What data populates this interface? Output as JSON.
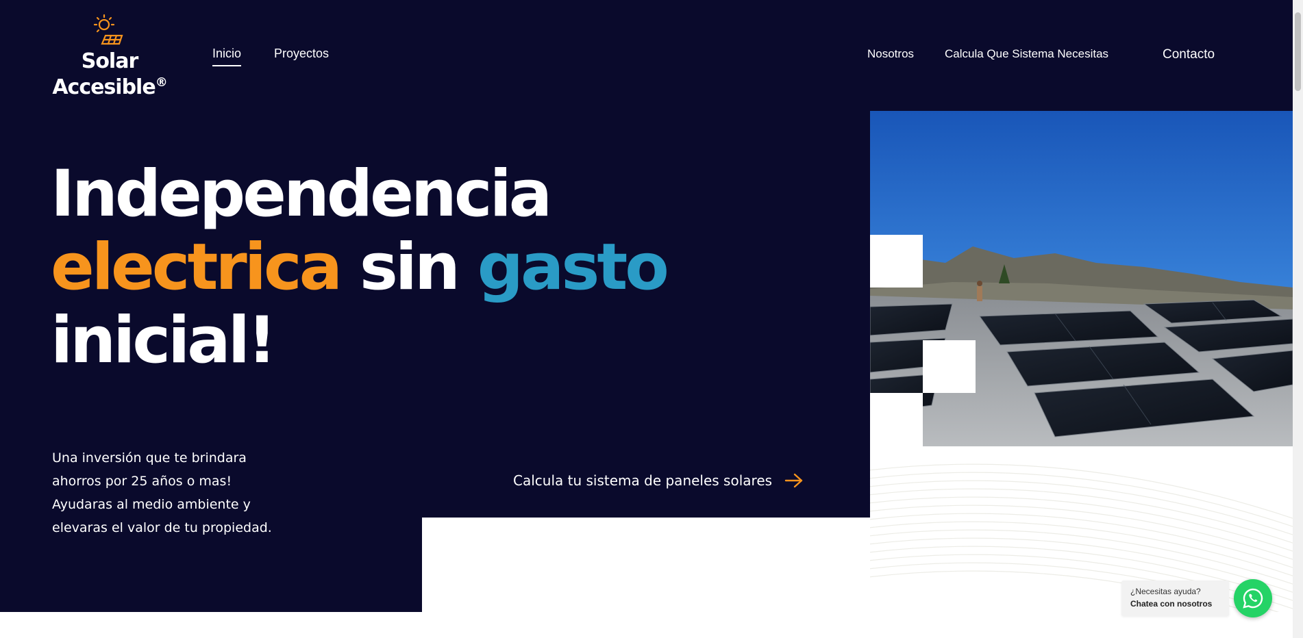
{
  "brand": {
    "name_line1": "Solar",
    "name_line2": "Accesible",
    "registered": "®",
    "logo_icon": "sun-solar-panel-icon"
  },
  "nav": {
    "left": [
      {
        "label": "Inicio",
        "active": true
      },
      {
        "label": "Proyectos",
        "active": false
      }
    ],
    "right": [
      {
        "label": "Nosotros"
      },
      {
        "label": "Calcula Que Sistema Necesitas"
      },
      {
        "label": "Contacto"
      }
    ]
  },
  "hero": {
    "headline_word1": "Independencia",
    "headline_word2": "electrica",
    "headline_word3": "sin",
    "headline_word4": "gasto",
    "headline_word5": "inicial!",
    "intro": "Una inversión que te brindara ahorros por 25 años o mas! Ayudaras al medio ambiente y elevaras el valor de tu propiedad.",
    "cta_label": "Calcula tu sistema de paneles solares",
    "cta_icon": "arrow-right-icon",
    "image_subject": "solar-panels-rooftop-photo"
  },
  "chat_widget": {
    "line1": "¿Necesitas ayuda?",
    "line2": "Chatea con nosotros",
    "icon": "whatsapp-icon"
  },
  "colors": {
    "background": "#0a0a2c",
    "accent_orange": "#f7941d",
    "accent_blue": "#2a9bc6",
    "whatsapp_green": "#25d366"
  }
}
